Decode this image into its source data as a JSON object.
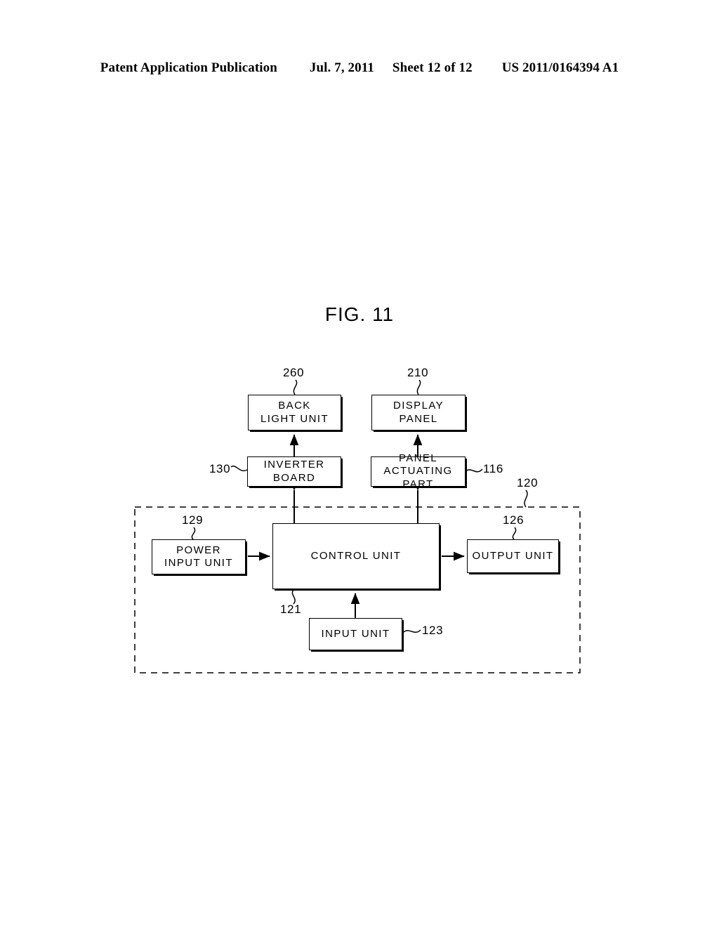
{
  "header": {
    "publication": "Patent Application Publication",
    "date": "Jul. 7, 2011",
    "sheet": "Sheet 12 of 12",
    "number": "US 2011/0164394 A1"
  },
  "figure": {
    "title": "FIG. 11"
  },
  "diagram": {
    "blocks": [
      {
        "id": "backlight",
        "label": "BACK\nLIGHT UNIT",
        "ref": "260"
      },
      {
        "id": "displaypanel",
        "label": "DISPLAY PANEL",
        "ref": "210"
      },
      {
        "id": "inverterboard",
        "label": "INVERTER BOARD",
        "ref": "130"
      },
      {
        "id": "panelactuating",
        "label": "PANEL\nACTUATING PART",
        "ref": "116"
      },
      {
        "id": "powerinput",
        "label": "POWER\nINPUT UNIT",
        "ref": "129"
      },
      {
        "id": "controlunit",
        "label": "CONTROL UNIT",
        "ref": "121"
      },
      {
        "id": "outputunit",
        "label": "OUTPUT UNIT",
        "ref": "126"
      },
      {
        "id": "inputunit",
        "label": "INPUT UNIT",
        "ref": "123"
      }
    ],
    "enclosure": {
      "label": "120",
      "style": "dashed"
    },
    "refs": {
      "backlight": "260",
      "displaypanel": "210",
      "inverterboard": "130",
      "panelactuating": "116",
      "enclosure": "120",
      "powerinput": "129",
      "outputunit": "126",
      "controlunit": "121",
      "inputunit": "123"
    },
    "connections": [
      {
        "from": "inverterboard",
        "to": "backlight",
        "arrow": "single"
      },
      {
        "from": "panelactuating",
        "to": "displaypanel",
        "arrow": "single"
      },
      {
        "from": "controlunit",
        "to": "inverterboard",
        "arrow": "double"
      },
      {
        "from": "controlunit",
        "to": "panelactuating",
        "arrow": "double"
      },
      {
        "from": "powerinput",
        "to": "controlunit",
        "arrow": "single"
      },
      {
        "from": "controlunit",
        "to": "outputunit",
        "arrow": "single"
      },
      {
        "from": "inputunit",
        "to": "controlunit",
        "arrow": "single"
      }
    ]
  },
  "colors": {
    "ink": "#000000",
    "paper": "#ffffff"
  }
}
